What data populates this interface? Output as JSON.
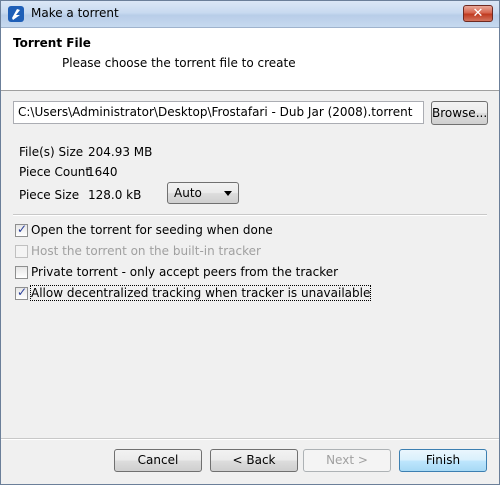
{
  "window": {
    "title": "Make a torrent",
    "close_glyph": "✕",
    "app_icon": "qbittorrent-icon"
  },
  "header": {
    "title": "Torrent File",
    "subtitle": "Please choose the torrent file to create"
  },
  "path": {
    "value": "C:\\Users\\Administrator\\Desktop\\Frostafari - Dub Jar (2008).torrent"
  },
  "browse_label": "Browse...",
  "info": {
    "files_size_label": "File(s) Size",
    "files_size_value": "204.93 MB",
    "piece_count_label": "Piece Count",
    "piece_count_value": "1640",
    "piece_size_label": "Piece Size",
    "piece_size_value": "128.0 kB",
    "piece_size_select": "Auto"
  },
  "options": [
    {
      "label": "Open the torrent for seeding when done",
      "checked": true,
      "enabled": true
    },
    {
      "label": "Host the torrent on the built-in tracker",
      "checked": false,
      "enabled": false
    },
    {
      "label": "Private torrent - only accept peers from the tracker",
      "checked": false,
      "enabled": true
    },
    {
      "label": "Allow decentralized tracking when tracker is unavailable",
      "checked": true,
      "enabled": true
    }
  ],
  "buttons": {
    "cancel": "Cancel",
    "back": "< Back",
    "next": "Next >",
    "finish": "Finish"
  }
}
